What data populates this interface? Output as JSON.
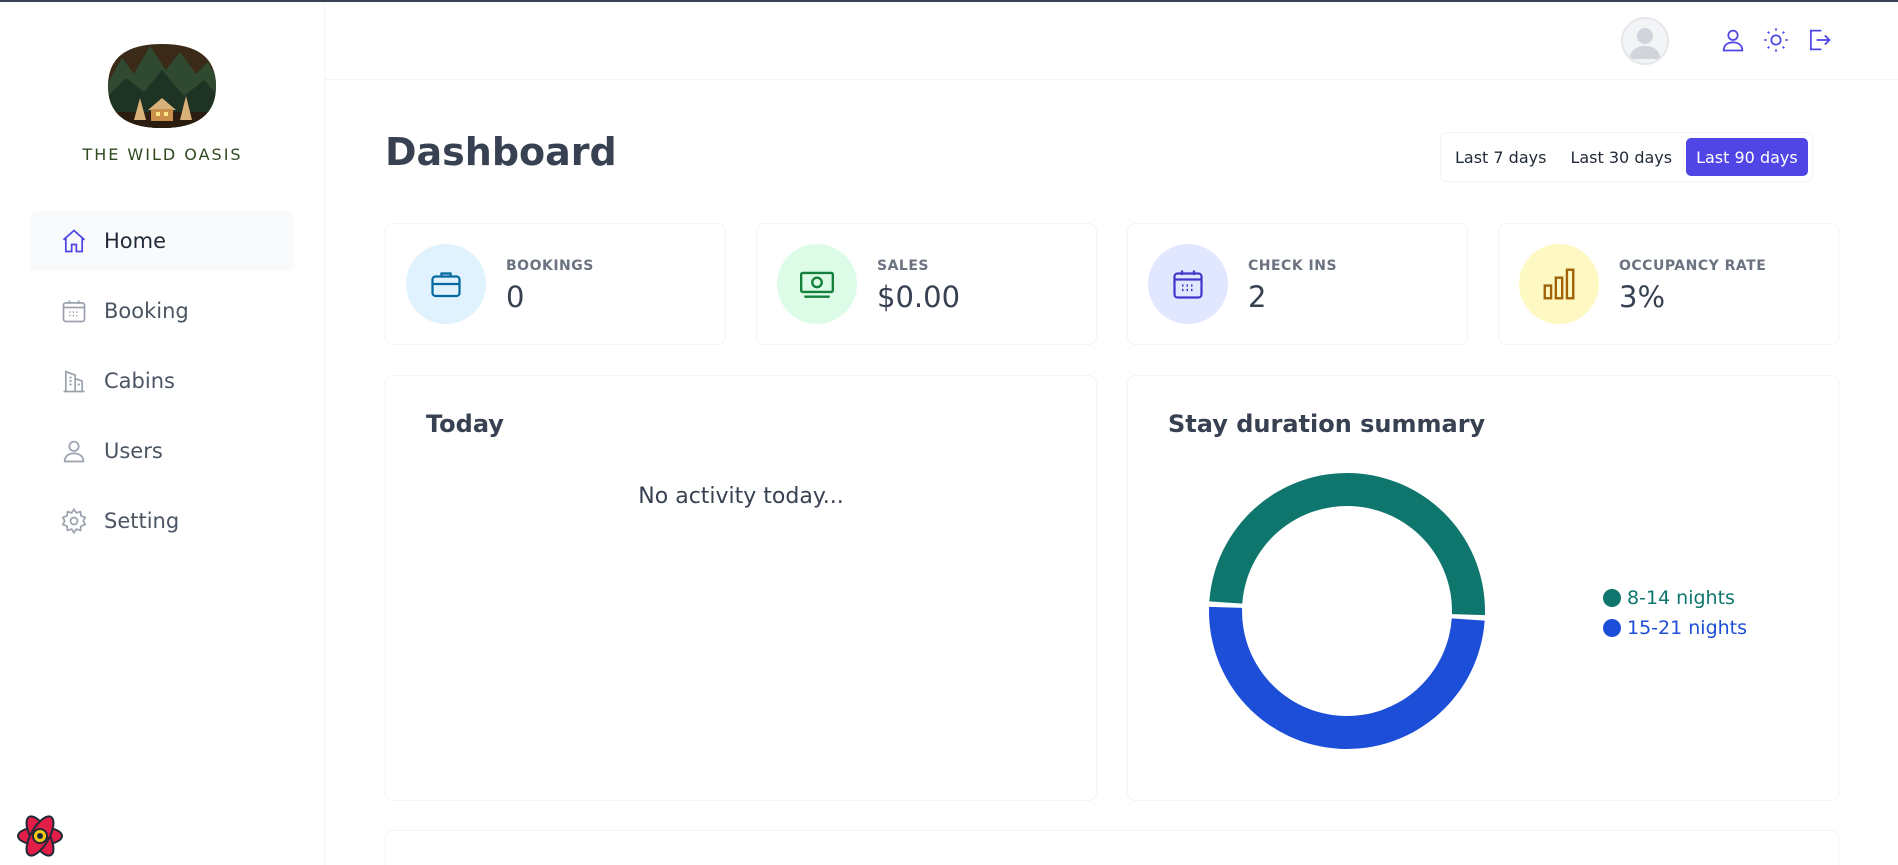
{
  "brand": {
    "name": "THE WILD OASIS"
  },
  "sidebar": {
    "items": [
      {
        "label": "Home",
        "icon": "home-icon",
        "active": true
      },
      {
        "label": "Booking",
        "icon": "calendar-icon",
        "active": false
      },
      {
        "label": "Cabins",
        "icon": "building-icon",
        "active": false
      },
      {
        "label": "Users",
        "icon": "user-icon",
        "active": false
      },
      {
        "label": "Setting",
        "icon": "gear-icon",
        "active": false
      }
    ]
  },
  "header": {
    "icons": [
      "user-icon",
      "sun-icon",
      "logout-icon"
    ]
  },
  "main": {
    "title": "Dashboard",
    "filters": [
      "Last 7 days",
      "Last 30 days",
      "Last 90 days"
    ],
    "active_filter": "Last 90 days"
  },
  "stats": [
    {
      "label": "BOOKINGS",
      "value": "0",
      "icon": "briefcase-icon",
      "color": "#e0f2fe"
    },
    {
      "label": "SALES",
      "value": "$0.00",
      "icon": "banknotes-icon",
      "color": "#dcfce7"
    },
    {
      "label": "CHECK INS",
      "value": "2",
      "icon": "calendar-days-icon",
      "color": "#e0e7ff"
    },
    {
      "label": "OCCUPANCY RATE",
      "value": "3%",
      "icon": "chart-bar-icon",
      "color": "#fef9c3"
    }
  ],
  "today": {
    "title": "Today",
    "empty": "No activity today..."
  },
  "duration": {
    "title": "Stay duration summary",
    "legend": [
      {
        "label": "8-14 nights",
        "color": "#0f766e"
      },
      {
        "label": "15-21 nights",
        "color": "#1d4ed8"
      }
    ]
  },
  "chart_data": {
    "type": "pie",
    "categories": [
      "8-14 nights",
      "15-21 nights"
    ],
    "values": [
      1,
      1
    ],
    "colors": [
      "#0f766e",
      "#1d4ed8"
    ],
    "title": "Stay duration summary",
    "legend": "right"
  }
}
